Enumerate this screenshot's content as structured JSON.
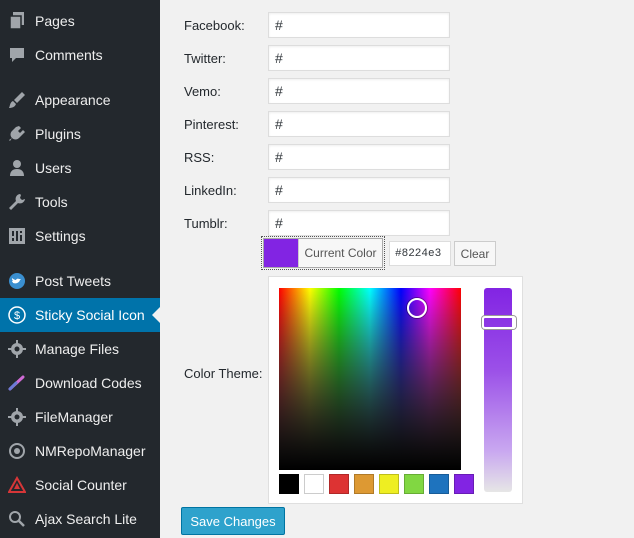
{
  "sidebar": {
    "items": [
      {
        "label": "Pages",
        "icon": "pages-icon"
      },
      {
        "label": "Comments",
        "icon": "comments-icon"
      },
      {
        "label": "Appearance",
        "icon": "appearance-icon"
      },
      {
        "label": "Plugins",
        "icon": "plugins-icon"
      },
      {
        "label": "Users",
        "icon": "users-icon"
      },
      {
        "label": "Tools",
        "icon": "tools-icon"
      },
      {
        "label": "Settings",
        "icon": "settings-icon"
      },
      {
        "label": "Post Tweets",
        "icon": "twitter-icon"
      },
      {
        "label": "Sticky Social Icon",
        "icon": "sticky-social-icon",
        "active": true
      },
      {
        "label": "Manage Files",
        "icon": "gear-icon"
      },
      {
        "label": "Download Codes",
        "icon": "download-codes-icon"
      },
      {
        "label": "FileManager",
        "icon": "gear-icon"
      },
      {
        "label": "NMRepoManager",
        "icon": "repo-icon"
      },
      {
        "label": "Social Counter",
        "icon": "social-counter-icon"
      },
      {
        "label": "Ajax Search Lite",
        "icon": "search-icon"
      }
    ]
  },
  "form": {
    "fields": [
      {
        "label": "Facebook:",
        "value": "#"
      },
      {
        "label": "Twitter:",
        "value": "#"
      },
      {
        "label": "Vemo:",
        "value": "#"
      },
      {
        "label": "Pinterest:",
        "value": "#"
      },
      {
        "label": "RSS:",
        "value": "#"
      },
      {
        "label": "LinkedIn:",
        "value": "#"
      },
      {
        "label": "Tumblr:",
        "value": "#"
      }
    ],
    "color_theme_label": "Color Theme:",
    "current_color_label": "Current Color",
    "current_color_value": "#8224e3",
    "clear_label": "Clear",
    "save_label": "Save Changes"
  },
  "colors": {
    "accent": "#8224e3",
    "sidebar_bg": "#23282d",
    "sidebar_active": "#0073aa",
    "button_primary": "#2ea2cc"
  },
  "palette": [
    "#000000",
    "#ffffff",
    "#dd3333",
    "#dd9933",
    "#eeee22",
    "#81d742",
    "#1e73be",
    "#8224e3"
  ]
}
